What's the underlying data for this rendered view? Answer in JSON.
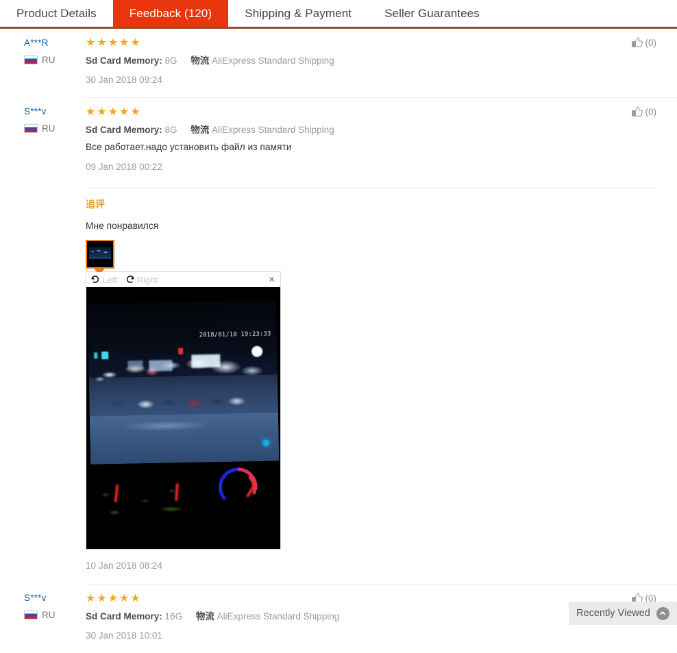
{
  "tabs": [
    {
      "label": "Product Details",
      "active": false
    },
    {
      "label": "Feedback (120)",
      "active": true
    },
    {
      "label": "Shipping & Payment",
      "active": false
    },
    {
      "label": "Seller Guarantees",
      "active": false
    }
  ],
  "colors": {
    "active_tab_bg": "#e8350d",
    "tab_underline": "#9c4a2a",
    "star": "#f5a623",
    "reviewer_link": "#0e5fad",
    "additional_title": "#e8a317",
    "thumbnail_border": "#f07d1a",
    "recently_viewed_bg": "#ebebeb"
  },
  "reviews": [
    {
      "reviewer": "A***R",
      "country": "RU",
      "country_flag": "ru-flag-icon",
      "stars": "★★★★★",
      "rating": 5,
      "attr_key": "Sd Card Memory:",
      "attr_val": "8G",
      "logistics_key": "物流",
      "logistics_val": "AliExpress Standard Shipping",
      "text": "",
      "date": "30 Jan 2018 09:24",
      "helpful_count": "(0)"
    },
    {
      "reviewer": "S***v",
      "country": "RU",
      "country_flag": "ru-flag-icon",
      "stars": "★★★★★",
      "rating": 5,
      "attr_key": "Sd Card Memory:",
      "attr_val": "8G",
      "logistics_key": "物流",
      "logistics_val": "AliExpress Standard Shipping",
      "text": "Все работает.надо установить файл из памяти",
      "date": "09 Jan 2018 00:22",
      "helpful_count": "(0)",
      "additional": {
        "title": "追评",
        "text": "Мне понравился",
        "date": "10 Jan 2018 08:24",
        "viewer": {
          "rotate_left_label": "Left",
          "rotate_right_label": "Right",
          "close_label": "×",
          "image_timestamp": "2018/01/10 19:23:33"
        }
      }
    },
    {
      "reviewer": "S***v",
      "country": "RU",
      "country_flag": "ru-flag-icon",
      "stars": "★★★★★",
      "rating": 5,
      "attr_key": "Sd Card Memory:",
      "attr_val": "16G",
      "logistics_key": "物流",
      "logistics_val": "AliExpress Standard Shipping",
      "text": "",
      "date": "30 Jan 2018 10:01",
      "helpful_count": "(0)"
    }
  ],
  "recently_viewed": {
    "label": "Recently Viewed",
    "icon": "chevron-up-circle-icon"
  }
}
